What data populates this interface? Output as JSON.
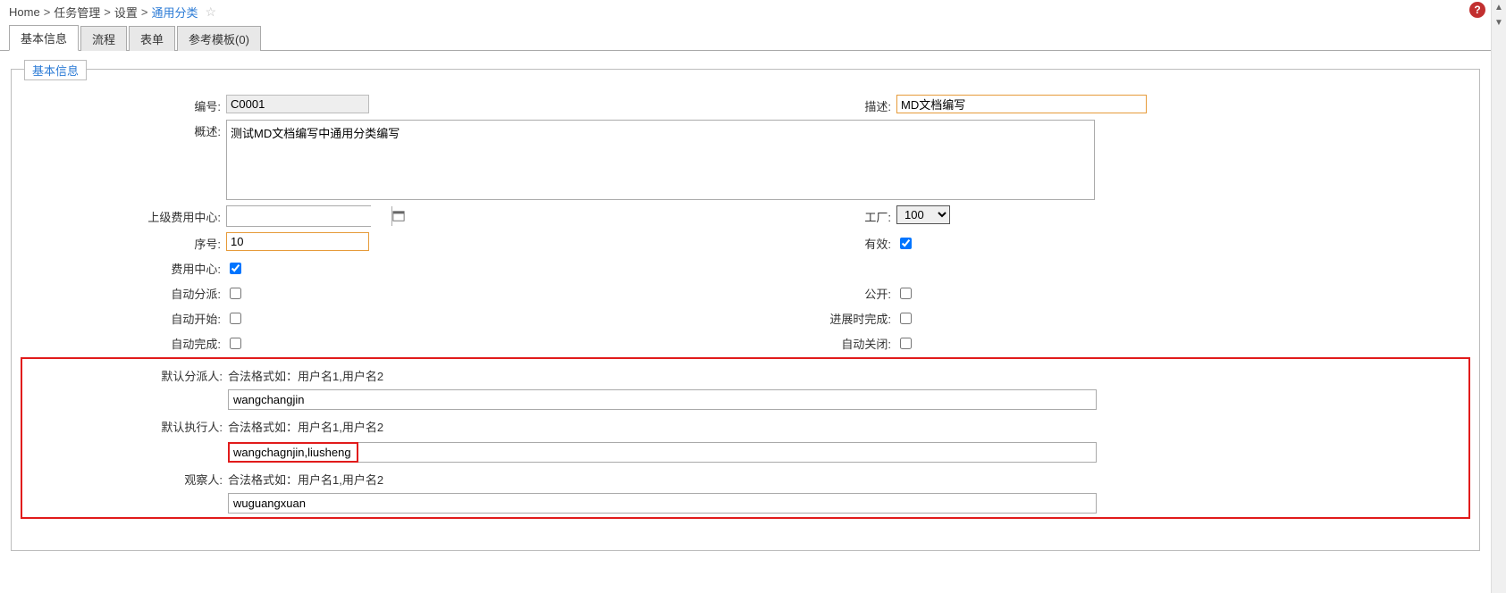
{
  "breadcrumb": {
    "items": [
      "Home",
      "任务管理",
      "设置",
      "通用分类"
    ],
    "sep": ">"
  },
  "icons": {
    "help": "?",
    "star": "☆"
  },
  "tabs": {
    "items": [
      {
        "label": "基本信息",
        "active": true
      },
      {
        "label": "流程",
        "active": false
      },
      {
        "label": "表单",
        "active": false
      },
      {
        "label": "参考模板(0)",
        "active": false
      }
    ]
  },
  "panel": {
    "legend": "基本信息"
  },
  "form": {
    "code_label": "编号:",
    "code_value": "C0001",
    "desc_label": "描述:",
    "desc_value": "MD文档编写",
    "overview_label": "概述:",
    "overview_value": "测试MD文档编写中通用分类编写",
    "parentcc_label": "上级费用中心:",
    "parentcc_value": "",
    "plant_label": "工厂:",
    "plant_value": "100",
    "plant_options": [
      "100"
    ],
    "seq_label": "序号:",
    "seq_value": "10",
    "valid_label": "有效:",
    "valid_checked": true,
    "cc_label": "费用中心:",
    "cc_checked": true,
    "autoassign_label": "自动分派:",
    "autoassign_checked": false,
    "public_label": "公开:",
    "public_checked": false,
    "autostart_label": "自动开始:",
    "autostart_checked": false,
    "progressdone_label": "进展时完成:",
    "progressdone_checked": false,
    "autodone_label": "自动完成:",
    "autodone_checked": false,
    "autoclose_label": "自动关闭:",
    "autoclose_checked": false,
    "assignee_label": "默认分派人:",
    "executor_label": "默认执行人:",
    "watcher_label": "观察人:",
    "format_hint": "合法格式如：用户名1,用户名2",
    "assignee_value": "wangchangjin",
    "executor_value": "wangchagnjin,liusheng",
    "watcher_value": "wuguangxuan"
  }
}
